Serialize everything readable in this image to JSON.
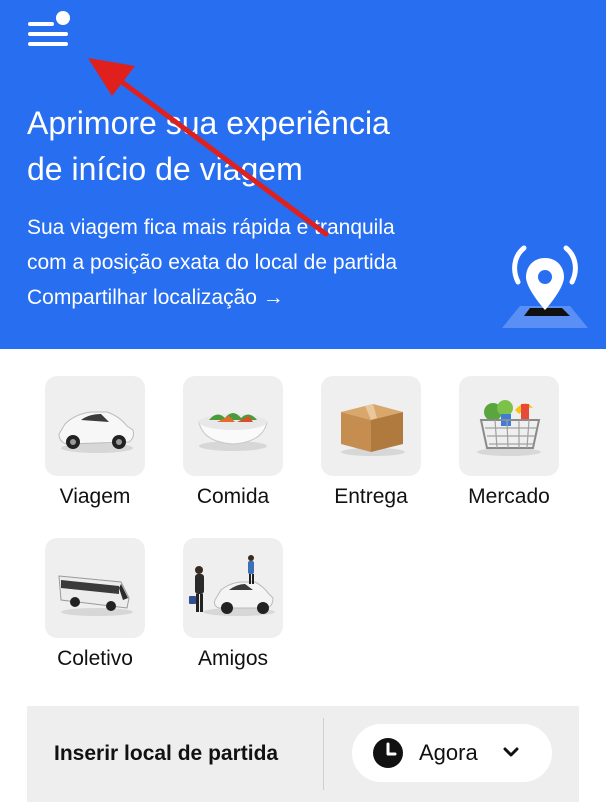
{
  "banner": {
    "title_line1": "Aprimore sua experiência",
    "title_line2": "de início de viagem",
    "text_line1": "Sua viagem fica mais rápida e tranquila",
    "text_line2": "com a posição exata do local de partida",
    "link": "Compartilhar localização →",
    "background": "#276ef1",
    "menu_icon": "menu-icon",
    "illustration": "location-pin-illustration"
  },
  "services": [
    {
      "label": "Viagem",
      "icon": "car-icon"
    },
    {
      "label": "Comida",
      "icon": "food-bowl-icon"
    },
    {
      "label": "Entrega",
      "icon": "package-icon"
    },
    {
      "label": "Mercado",
      "icon": "grocery-basket-icon"
    },
    {
      "label": "Coletivo",
      "icon": "bus-icon"
    },
    {
      "label": "Amigos",
      "icon": "friends-car-icon"
    }
  ],
  "bottom": {
    "pickup_label": "Inserir local de partida",
    "schedule_label": "Agora",
    "schedule_icon": "clock-icon",
    "dropdown_icon": "chevron-down-icon"
  },
  "colors": {
    "accent": "#276ef1",
    "annotation_arrow": "#e0201c",
    "tile_bg": "#efefef",
    "bottom_bar_bg": "#eeeeee"
  }
}
